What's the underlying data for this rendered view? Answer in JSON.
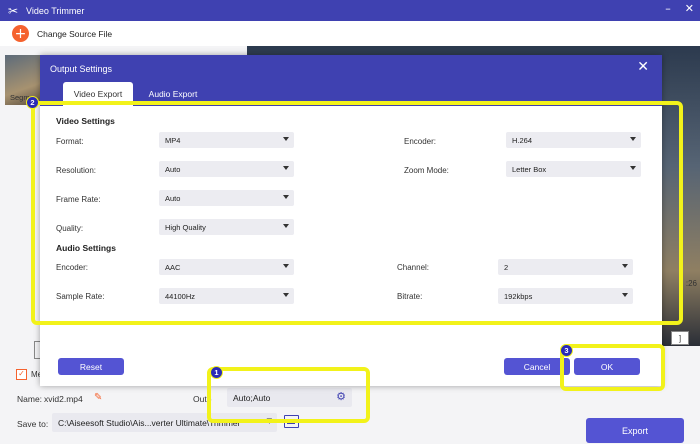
{
  "app": {
    "title": "Video Trimmer"
  },
  "topbar": {
    "change_source": "Change Source File"
  },
  "left_panel": {
    "segment_label": "Segme",
    "merge_label": "Me"
  },
  "preview": {
    "time_right": ":26",
    "bracket": "]"
  },
  "bottom": {
    "name_label": "Name:",
    "name_value": "xvid2.mp4",
    "output_label": "Outp",
    "output_value": "Auto;Auto",
    "save_label": "Save to:",
    "save_value": "C:\\Aiseesoft Studio\\Ais...verter Ultimate\\Trimmer",
    "export_label": "Export"
  },
  "modal": {
    "title": "Output Settings",
    "tabs": [
      "Video Export",
      "Audio Export"
    ],
    "video_section": "Video Settings",
    "audio_section": "Audio Settings",
    "format": {
      "label": "Format:",
      "value": "MP4"
    },
    "resolution": {
      "label": "Resolution:",
      "value": "Auto"
    },
    "frame_rate": {
      "label": "Frame Rate:",
      "value": "Auto"
    },
    "quality": {
      "label": "Quality:",
      "value": "High Quality"
    },
    "encoder": {
      "label": "Encoder:",
      "value": "H.264"
    },
    "zoom_mode": {
      "label": "Zoom Mode:",
      "value": "Letter Box"
    },
    "audio_encoder": {
      "label": "Encoder:",
      "value": "AAC"
    },
    "sample_rate": {
      "label": "Sample Rate:",
      "value": "44100Hz"
    },
    "channel": {
      "label": "Channel:",
      "value": "2"
    },
    "bitrate": {
      "label": "Bitrate:",
      "value": "192kbps"
    },
    "reset_label": "Reset",
    "cancel_label": "Cancel",
    "ok_label": "OK"
  },
  "annotations": {
    "badge1": "1",
    "badge2": "2",
    "badge3": "3"
  },
  "colors": {
    "accent": "#3f41b1",
    "button": "#5454d3",
    "highlight": "#f2f21a",
    "orange": "#f5622e"
  }
}
